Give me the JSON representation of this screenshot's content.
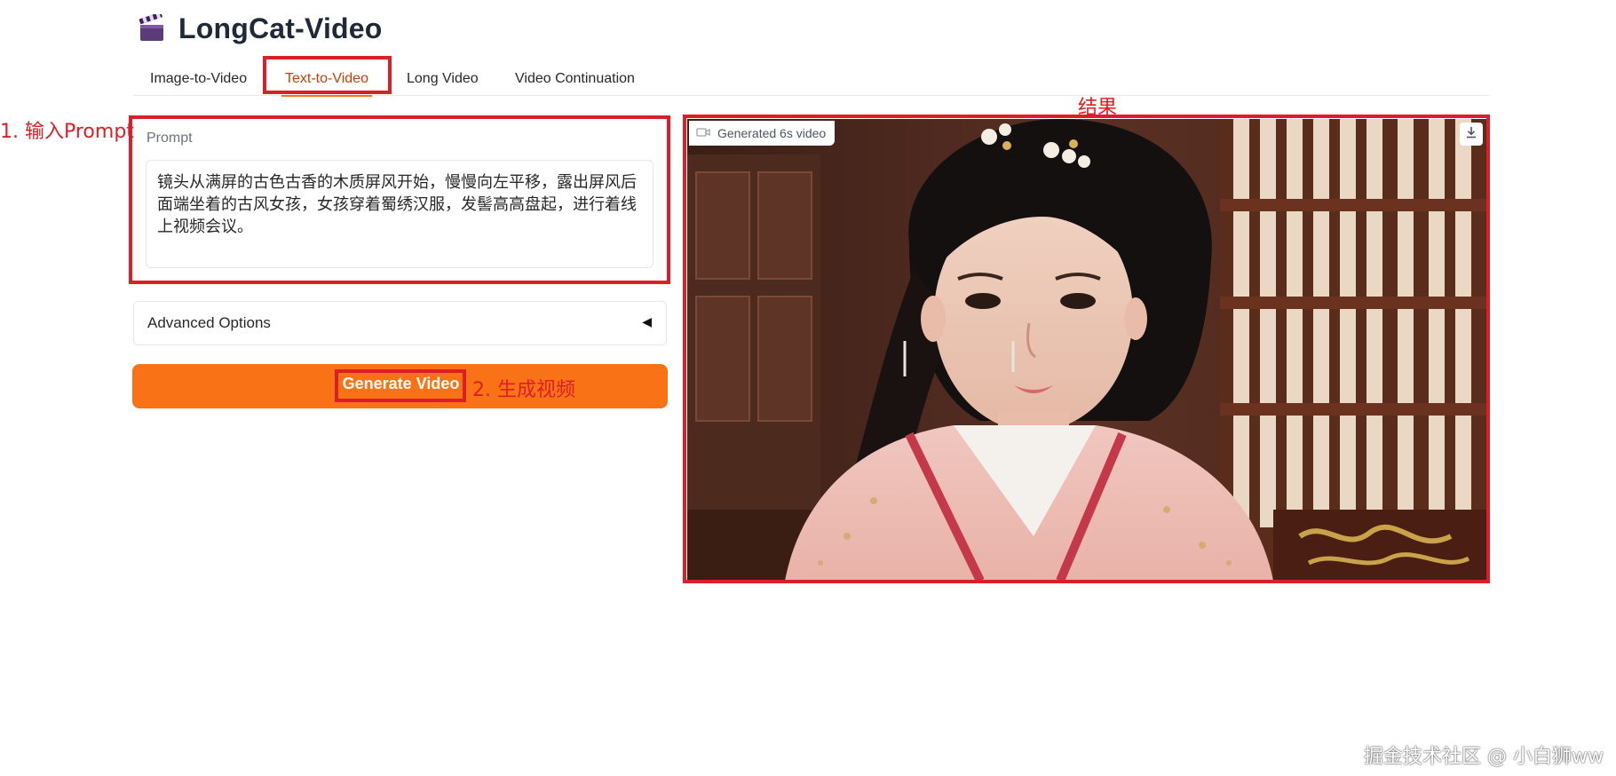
{
  "app": {
    "title": "LongCat-Video",
    "icon": "clapperboard-icon"
  },
  "tabs": [
    {
      "label": "Image-to-Video",
      "active": false
    },
    {
      "label": "Text-to-Video",
      "active": true
    },
    {
      "label": "Long Video",
      "active": false
    },
    {
      "label": "Video Continuation",
      "active": false
    }
  ],
  "prompt": {
    "label": "Prompt",
    "value": "镜头从满屏的古色古香的木质屏风开始，慢慢向左平移，露出屏风后面端坐着的古风女孩，女孩穿着蜀绣汉服，发髻高高盘起，进行着线上视频会议。"
  },
  "advanced": {
    "label": "Advanced Options",
    "caret": "◀"
  },
  "generate": {
    "label": "Generate Video"
  },
  "output": {
    "badge": "Generated 6s video",
    "download_icon": "download-icon"
  },
  "annotations": {
    "step1": "1. 输入Prompt",
    "step2": "2. 生成视频",
    "result": "结果"
  },
  "watermark": "掘金技术社区 @ 小白狮ww",
  "colors": {
    "accent": "#f97316",
    "active_tab": "#c2410c",
    "annotation": "#dc1f26"
  }
}
